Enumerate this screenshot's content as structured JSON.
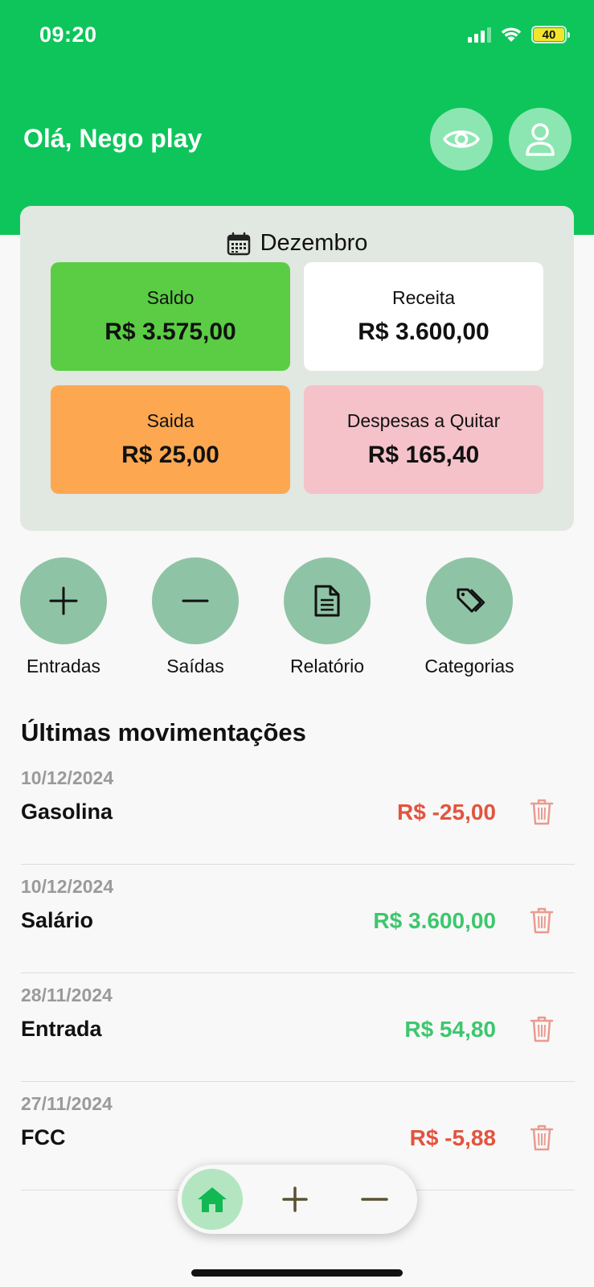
{
  "status_bar": {
    "time": "09:20",
    "battery": "40"
  },
  "header": {
    "greeting": "Olá, Nego play",
    "eye_icon": "eye-icon",
    "profile_icon": "user-icon"
  },
  "summary": {
    "month": "Dezembro",
    "cards": [
      {
        "label": "Saldo",
        "value": "R$ 3.575,00",
        "color": "#5bcd45"
      },
      {
        "label": "Receita",
        "value": "R$ 3.600,00",
        "color": "#ffffff"
      },
      {
        "label": "Saida",
        "value": "R$ 25,00",
        "color": "#fda851"
      },
      {
        "label": "Despesas a Quitar",
        "value": "R$ 165,40",
        "color": "#f6c2c9"
      }
    ]
  },
  "actions": [
    {
      "label": "Entradas",
      "icon": "plus-icon"
    },
    {
      "label": "Saídas",
      "icon": "minus-icon"
    },
    {
      "label": "Relatório",
      "icon": "document-icon"
    },
    {
      "label": "Categorias",
      "icon": "tag-icon"
    }
  ],
  "movements": {
    "title": "Últimas movimentações",
    "items": [
      {
        "date": "10/12/2024",
        "name": "Gasolina",
        "amount": "R$ -25,00",
        "type": "expense"
      },
      {
        "date": "10/12/2024",
        "name": "Salário",
        "amount": "R$ 3.600,00",
        "type": "income"
      },
      {
        "date": "28/11/2024",
        "name": "Entrada",
        "amount": "R$ 54,80",
        "type": "income"
      },
      {
        "date": "27/11/2024",
        "name": "FCC",
        "amount": "R$ -5,88",
        "type": "expense"
      }
    ]
  },
  "bottom_nav": [
    {
      "icon": "home-icon",
      "active": true
    },
    {
      "icon": "plus-icon",
      "active": false
    },
    {
      "icon": "minus-icon",
      "active": false
    }
  ],
  "colors": {
    "brand_green": "#0ec55b",
    "income_green": "#3cc76c",
    "expense_red": "#e2543f",
    "action_circle": "#8fc3a5"
  }
}
